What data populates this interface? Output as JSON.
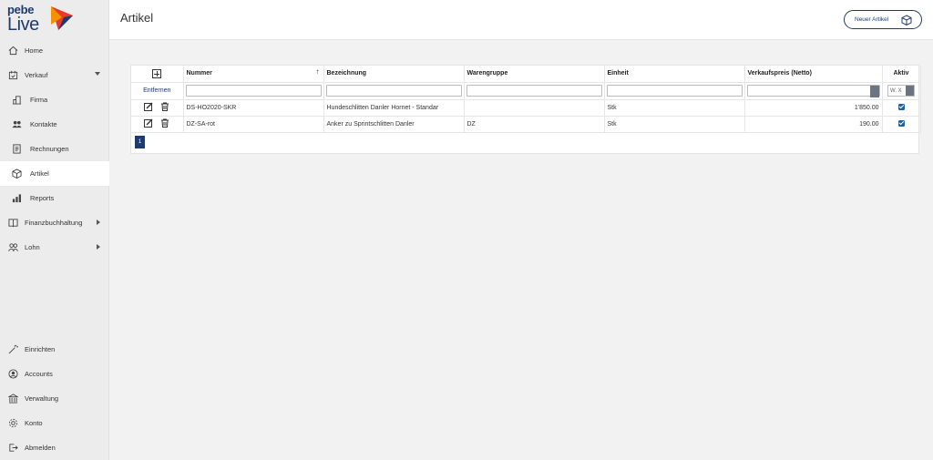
{
  "brand": {
    "line1": "pebe",
    "line2": "Live"
  },
  "sidebar": {
    "top": [
      {
        "label": "Home",
        "icon": "home-icon"
      },
      {
        "label": "Verkauf",
        "icon": "sales-icon"
      },
      {
        "label": "Firma",
        "icon": "company-icon"
      },
      {
        "label": "Kontakte",
        "icon": "contacts-icon"
      },
      {
        "label": "Rechnungen",
        "icon": "invoice-icon"
      },
      {
        "label": "Artikel",
        "icon": "box-icon"
      },
      {
        "label": "Reports",
        "icon": "chart-icon"
      },
      {
        "label": "Finanzbuchhaltung",
        "icon": "book-icon"
      },
      {
        "label": "Lohn",
        "icon": "people-icon"
      }
    ],
    "bottom": [
      {
        "label": "Einrichten",
        "icon": "magic-wand-icon"
      },
      {
        "label": "Accounts",
        "icon": "account-icon"
      },
      {
        "label": "Verwaltung",
        "icon": "bank-icon"
      },
      {
        "label": "Konto",
        "icon": "gear-icon"
      },
      {
        "label": "Abmelden",
        "icon": "logout-icon"
      }
    ]
  },
  "header": {
    "title": "Artikel",
    "new_button": "Neuer Artikel"
  },
  "table": {
    "columns": [
      "Nummer",
      "Bezeichnung",
      "Warengruppe",
      "Einheit",
      "Verkaufspreis (Netto)",
      "Aktiv"
    ],
    "remove_label": "Entfernen",
    "aktiv_filter": "W. X",
    "rows": [
      {
        "nummer": "DS-HO2020-SKR",
        "bezeichnung": "Hundeschlitten Danler Hornet - Standar",
        "warengruppe": "",
        "einheit": "Stk",
        "preis": "1'850.00",
        "aktiv": true
      },
      {
        "nummer": "DZ-SA-rot",
        "bezeichnung": "Anker zu Sprintschlitten Danler",
        "warengruppe": "DZ",
        "einheit": "Stk",
        "preis": "190.00",
        "aktiv": true
      }
    ]
  },
  "pagination": {
    "current": "1"
  },
  "colors": {
    "accent": "#1f3b6d",
    "brand_red": "#e8392f",
    "brand_orange": "#f39200"
  }
}
